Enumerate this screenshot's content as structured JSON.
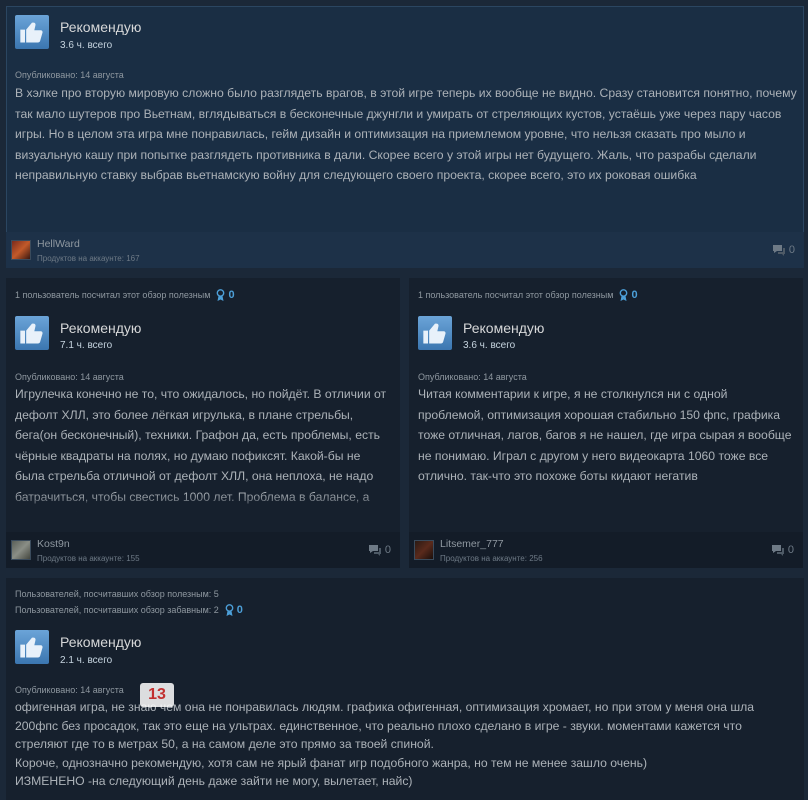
{
  "reviews": [
    {
      "recommend_label": "Рекомендую",
      "hours": "3.6 ч. всего",
      "posted": "Опубликовано: 14 августа",
      "text": "В хэлке про вторую мировую сложно было разглядеть врагов, в этой игре теперь их вообще не видно. Сразу становится понятно, почему так мало шутеров про Вьетнам, вглядываться в бесконечные джунгли и умирать от стреляющих кустов, устаёшь уже через пару часов игры. Но в целом эта игра мне понравилась, гейм дизайн и оптимизация на приемлемом уровне, что нельзя сказать про мыло и визуальную кашу при попытке разглядеть противника в дали. Скорее всего у этой игры нет будущего. Жаль, что разрабы сделали неправильную ставку выбрав вьетнамскую войну для следующего своего проекта, скорее всего, это их роковая ошибка",
      "username": "HellWard",
      "products": "Продуктов на аккаунте: 167",
      "comments": "0"
    },
    {
      "helpful": "1 пользователь посчитал этот обзор полезным",
      "awards": "0",
      "recommend_label": "Рекомендую",
      "hours": "7.1 ч. всего",
      "posted": "Опубликовано: 14 августа",
      "text": "Игрулечка конечно не то, что ожидалось, но пойдёт. В отличии от дефолт ХЛЛ, это более лёгкая игрулька, в плане стрельбы, бега(он бесконечный), техники. Графон да, есть проблемы, есть чёрные квадраты на полях, но думаю пофиксят. Какой-бы не была стрельба отличной от дефолт ХЛЛ, она неплоха, не надо батрачиться, чтобы свестись 1000 лет. Проблема в балансе, а именно в бомжах на тиммейтах, которые просто не могут поставить",
      "username": "Kost9n",
      "products": "Продуктов на аккаунте: 155",
      "comments": "0"
    },
    {
      "helpful": "1 пользователь посчитал этот обзор полезным",
      "awards": "0",
      "recommend_label": "Рекомендую",
      "hours": "3.6 ч. всего",
      "posted": "Опубликовано: 14 августа",
      "text": "Читая комментарии к игре, я не столкнулся ни с одной проблемой, оптимизация хорошая стабильно 150 фпс, графика тоже отличная, лагов, багов я не нашел, где игра сырая я вообще не понимаю. Играл с другом у него видеокарта 1060 тоже все отлично. так-что это похоже боты кидают негатив",
      "username": "Litsemer_777",
      "products": "Продуктов на аккаунте: 256",
      "comments": "0"
    },
    {
      "helpful": "Пользователей, посчитавших обзор полезным: 5",
      "funny": "Пользователей, посчитавших обзор забавным: 2",
      "awards": "0",
      "recommend_label": "Рекомендую",
      "hours": "2.1 ч. всего",
      "posted": "Опубликовано: 14 августа",
      "badge": "13",
      "text_lines": [
        "офигенная игра, не знаю чем она не понравилась людям. графика офигенная, оптимизация хромает, но при этом у меня она шла 200фпс без просадок, так это еще на ультрах. единственное, что реально плохо сделано в игре - звуки. моментами кажется что стреляют где то в метрах 50, а на самом деле это прямо за твоей спиной.",
        "Короче, однозначно рекомендую, хотя сам не ярый фанат игр подобного жанра, но тем не менее зашло очень)",
        "ИЗМЕНЕНО -на следующий день даже зайти не могу, вылетает, найс)"
      ]
    }
  ],
  "colors": {
    "background": "#1b2838",
    "card": "#16202d",
    "thumb": "#4f8ac4",
    "award": "#4c9fd8"
  },
  "icons": [
    "thumbs-up-icon",
    "award-icon",
    "comment-icon"
  ]
}
